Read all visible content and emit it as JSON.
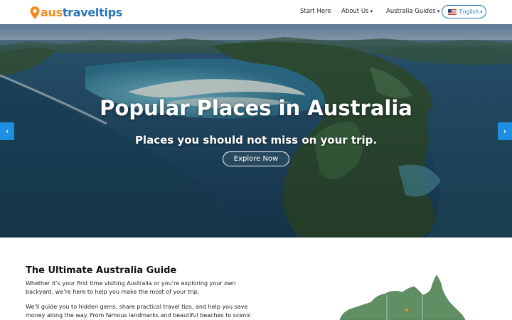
{
  "brand": {
    "part1": "aus",
    "part2": "traveltips"
  },
  "nav": {
    "start_here": "Start Here",
    "about_us": "About Us",
    "australia_guides": "Australia Guides",
    "language": "English",
    "chevron": "⌄"
  },
  "hero": {
    "title": "Popular Places in Australia",
    "subtitle": "Places you should not miss on your trip.",
    "cta": "Explore Now",
    "prev_icon": "‹",
    "next_icon": "›"
  },
  "intro": {
    "title": "The Ultimate Australia Guide",
    "paragraph1": "Whether it’s your first time visiting Australia or you’re exploring your own backyard, we’re here to help you make the most of your trip.",
    "paragraph2": "We’ll guide you to hidden gems, share practical travel tips, and help you save money along the way. From famous landmarks and beautiful beaches to scenic"
  },
  "colors": {
    "brand_orange": "#f58a1f",
    "brand_blue": "#2a74b8",
    "arrow_blue": "#1d8ee2",
    "map_green": "#5f8f63"
  },
  "icons": {
    "logo": "location-pin-icon",
    "language": "us-flag-icon",
    "prev": "chevron-left-icon",
    "next": "chevron-right-icon"
  }
}
